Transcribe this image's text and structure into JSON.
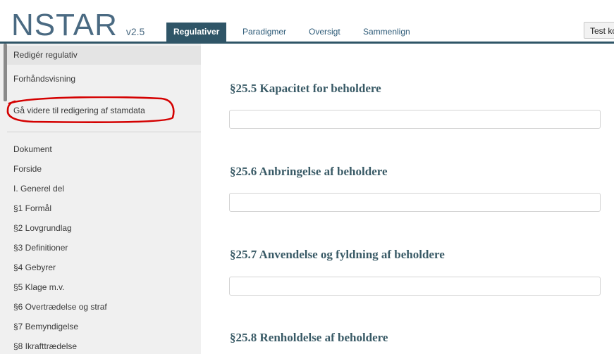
{
  "app": {
    "name": "NSTAR",
    "version": "v2.5"
  },
  "tabs": [
    {
      "label": "Regulativer",
      "active": true
    },
    {
      "label": "Paradigmer"
    },
    {
      "label": "Oversigt"
    },
    {
      "label": "Sammenlign"
    }
  ],
  "header": {
    "test_button": "Test ko"
  },
  "sidebar": {
    "top_items": [
      {
        "label": "Redigér regulativ"
      },
      {
        "label": "Forhåndsvisning"
      },
      {
        "label": "Gå videre til redigering af stamdata"
      }
    ],
    "nav_items": [
      {
        "label": "Dokument"
      },
      {
        "label": "Forside"
      },
      {
        "label": "I. Generel del"
      },
      {
        "label": "§1 Formål"
      },
      {
        "label": "§2 Lovgrundlag"
      },
      {
        "label": "§3 Definitioner"
      },
      {
        "label": "§4 Gebyrer"
      },
      {
        "label": "§5 Klage m.v."
      },
      {
        "label": "§6 Overtrædelse og straf"
      },
      {
        "label": "§7 Bemyndigelse"
      },
      {
        "label": "§8 Ikrafttrædelse"
      }
    ]
  },
  "main": {
    "sections": [
      {
        "heading": "§25.5 Kapacitet for beholdere",
        "value": ""
      },
      {
        "heading": "§25.6 Anbringelse af beholdere",
        "value": ""
      },
      {
        "heading": "§25.7 Anvendelse og fyldning af beholdere",
        "value": ""
      },
      {
        "heading": "§25.8 Renholdelse af beholdere"
      }
    ]
  },
  "colors": {
    "accent": "#2f5567",
    "heading": "#395a66",
    "annotation": "#d40000",
    "sidebar_bg": "#f0f0f0"
  }
}
